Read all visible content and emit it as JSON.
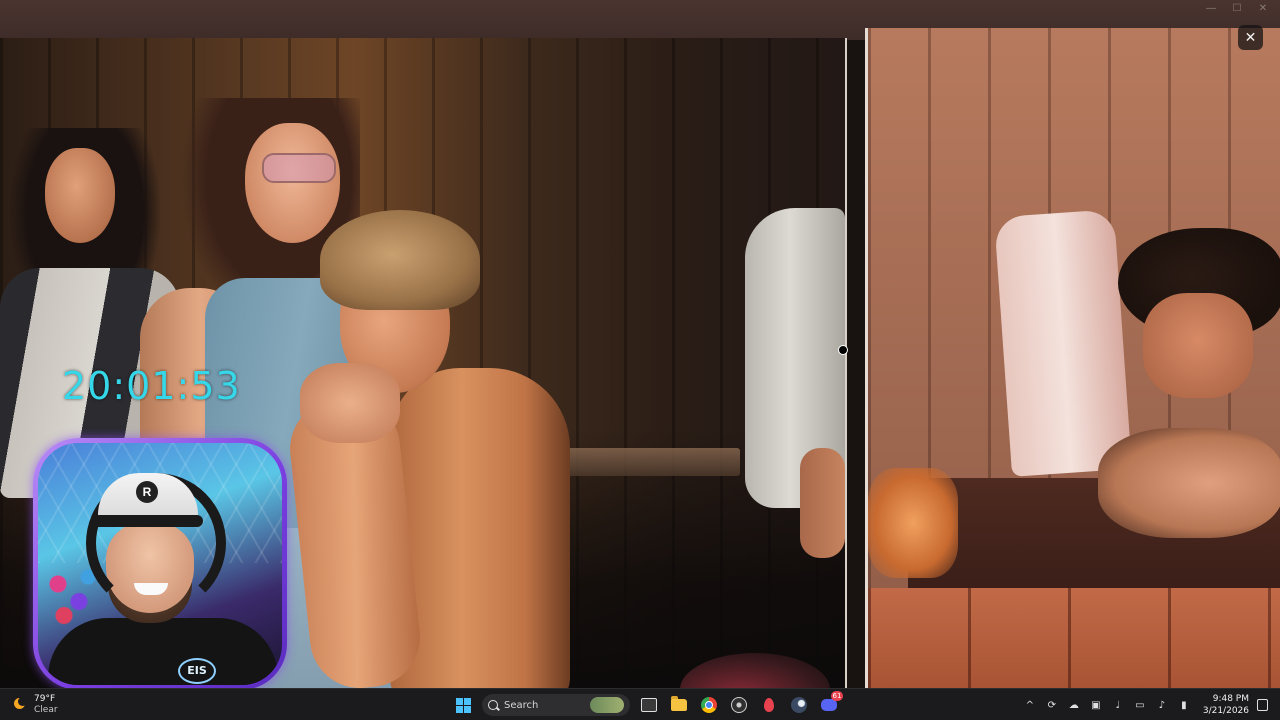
{
  "viewer": {
    "close_glyph": "✕",
    "window_controls": {
      "minimize": "—",
      "maximize": "☐",
      "close": "✕"
    }
  },
  "overlay": {
    "clock": "20:01:53"
  },
  "webcam": {
    "shirt_logo": "EIS",
    "cap_logo": "R"
  },
  "taskbar": {
    "weather": {
      "temp": "79°F",
      "condition": "Clear",
      "icon": "moon-sun-icon"
    },
    "search": {
      "label": "Search"
    },
    "pinned": [
      {
        "name": "start-icon"
      },
      {
        "name": "search-icon"
      },
      {
        "name": "task-view-icon"
      },
      {
        "name": "file-explorer-icon"
      },
      {
        "name": "chrome-icon"
      },
      {
        "name": "obs-icon"
      },
      {
        "name": "maps-pin-icon"
      },
      {
        "name": "steam-icon"
      },
      {
        "name": "discord-icon"
      }
    ],
    "discord_badge": "61",
    "tray": {
      "chevron": "^",
      "time": "9:48 PM",
      "date": "3/21/2026"
    }
  }
}
